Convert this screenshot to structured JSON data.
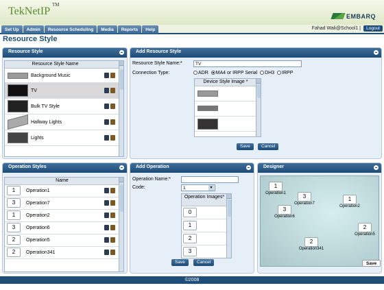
{
  "app": {
    "name": "TekNetIP",
    "tm": "TM",
    "brand": "EMBARQ"
  },
  "nav": {
    "items": [
      "Set Up",
      "Admin",
      "Resource Scheduling",
      "Media",
      "Reports",
      "Help"
    ]
  },
  "user": {
    "text": "Fahad Wali@School1 |",
    "logout": "Logout"
  },
  "page": {
    "title": "Resource Style"
  },
  "resource_style": {
    "title": "Resource Style",
    "col": "Resource Style Name",
    "rows": [
      {
        "name": "Background Music",
        "selected": false
      },
      {
        "name": "TV",
        "selected": true
      },
      {
        "name": "Bulk TV Style",
        "selected": false
      },
      {
        "name": "Hallway Lights",
        "selected": false
      },
      {
        "name": "Lights",
        "selected": false
      }
    ]
  },
  "add_resource_style": {
    "title": "Add Resource Style",
    "name_label": "Resource Style Name:*",
    "name_value": "TV",
    "conn_label": "Connection Type:",
    "conn_options": [
      "ADR",
      "MA4 or IRPP Serial",
      "DH3",
      "IRPP"
    ],
    "conn_selected": "MA4 or IRPP Serial",
    "image_header": "Device Style Image *",
    "save": "Save",
    "cancel": "Cancel"
  },
  "operation_styles": {
    "title": "Operation Styles",
    "col": "Name",
    "rows": [
      {
        "num": "1",
        "name": "Operation1"
      },
      {
        "num": "3",
        "name": "Operation7"
      },
      {
        "num": "1",
        "name": "Operation2"
      },
      {
        "num": "3",
        "name": "Operation6"
      },
      {
        "num": "2",
        "name": "Operation5"
      },
      {
        "num": "2",
        "name": "Operation341"
      }
    ]
  },
  "add_operation": {
    "title": "Add Operation",
    "name_label": "Operation Name:*",
    "name_value": "",
    "code_label": "Code:",
    "code_value": "1",
    "images_header": "Operation Images*",
    "images": [
      "0",
      "1",
      "2",
      "3"
    ],
    "save": "Save",
    "cancel": "Cancel"
  },
  "designer": {
    "title": "Designer",
    "nodes": [
      {
        "num": "1",
        "label": "Operation1"
      },
      {
        "num": "3",
        "label": "Operation7"
      },
      {
        "num": "1",
        "label": "Operation2"
      },
      {
        "num": "3",
        "label": "Operation6"
      },
      {
        "num": "2",
        "label": "Operation5"
      },
      {
        "num": "2",
        "label": "Operation341"
      }
    ],
    "save": "Save"
  },
  "footer": {
    "text": "©2008"
  }
}
